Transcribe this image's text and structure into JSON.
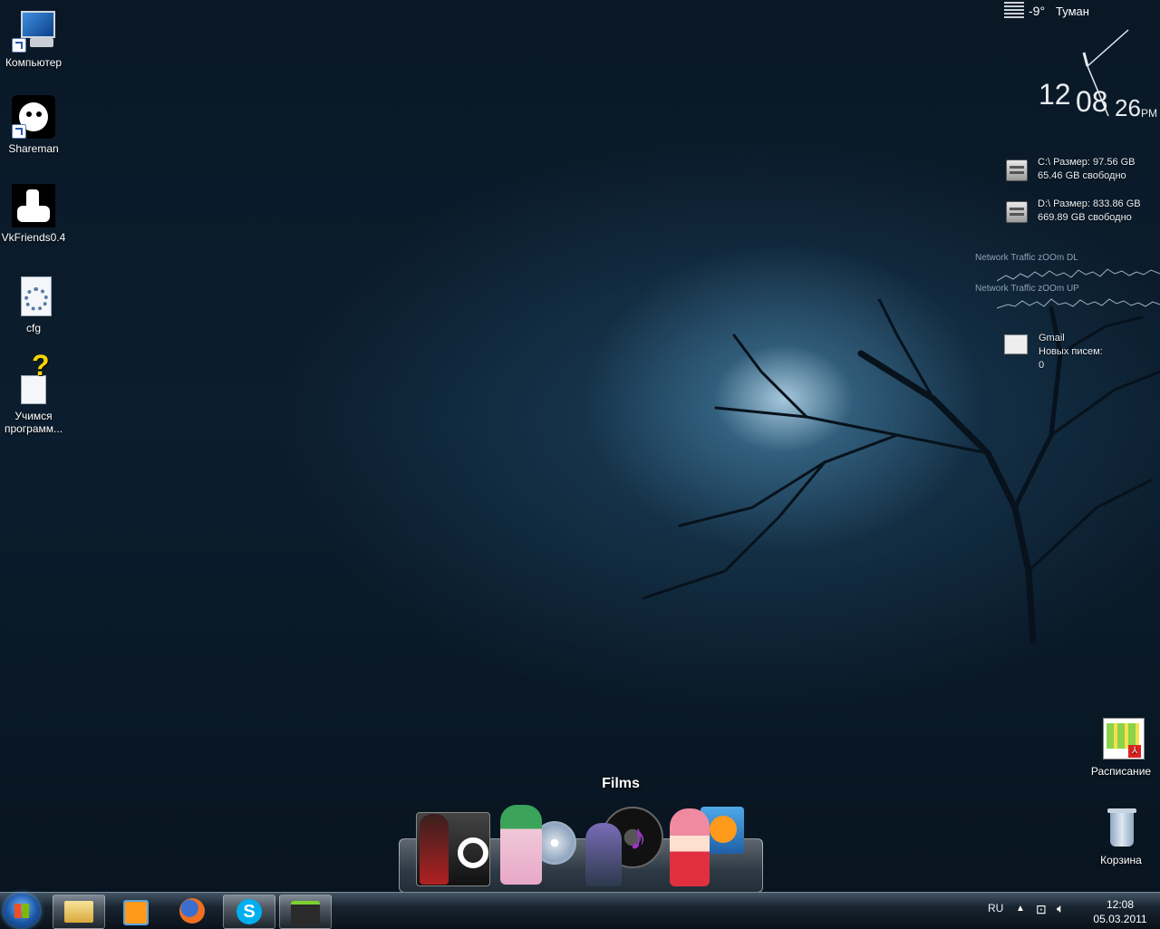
{
  "desktop_icons": [
    {
      "label": "Компьютер",
      "icon": "computer-icon"
    },
    {
      "label": "Shareman",
      "icon": "shareman-icon"
    },
    {
      "label": "VkFriends0.4",
      "icon": "vkfriends-icon"
    },
    {
      "label": "cfg",
      "icon": "config-file-icon"
    },
    {
      "label": "Учимся программ...",
      "icon": "help-file-icon"
    },
    {
      "label": "Расписание",
      "icon": "pdf-schedule-icon"
    },
    {
      "label": "Корзина",
      "icon": "recycle-bin-icon"
    }
  ],
  "weather": {
    "temp": "-9°",
    "condition": "Туман"
  },
  "clock": {
    "hours": "12",
    "minutes": "08",
    "seconds": "26",
    "ampm": "PM"
  },
  "drives": [
    {
      "line1": "C:\\  Размер: 97.56 GB",
      "line2": "65.46 GB свободно"
    },
    {
      "line1": "D:\\  Размер: 833.86 GB",
      "line2": "669.89 GB свободно"
    }
  ],
  "network": {
    "dl_label": "Network Traffic zOOm DL",
    "up_label": "Network Traffic zOOm UP"
  },
  "gmail": {
    "title": "Gmail",
    "label": "Новых писем:",
    "count": "0"
  },
  "dock": {
    "title": "Films"
  },
  "taskbar": {
    "items": [
      "windows-explorer-icon",
      "media-player-icon",
      "firefox-icon",
      "skype-icon",
      "qip-icon"
    ],
    "tray": {
      "lang": "RU",
      "time": "12:08",
      "date": "05.03.2011"
    }
  },
  "colors": {
    "accent": "#1b56a5",
    "background": "#0b1d2e"
  }
}
